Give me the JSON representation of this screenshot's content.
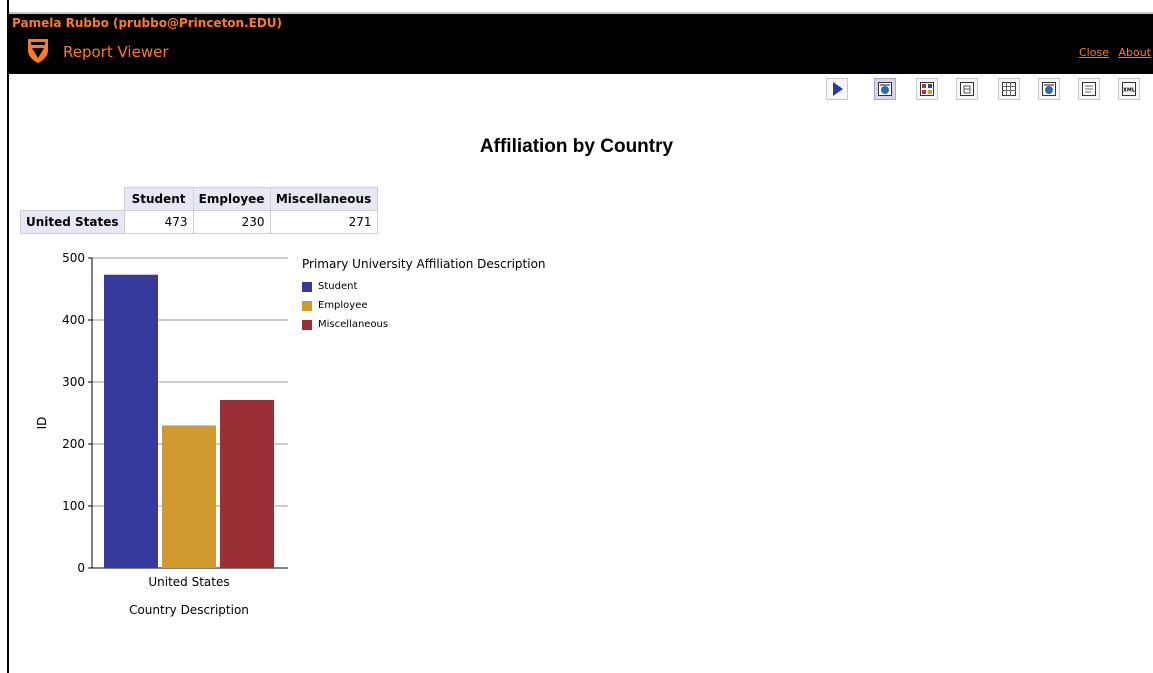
{
  "header": {
    "user": "Pamela Rubbo (prubbo@Princeton.EDU)",
    "app_title": "Report Viewer",
    "links": {
      "close": "Close",
      "about": "About"
    }
  },
  "toolbar": {
    "buttons": [
      {
        "name": "run-button",
        "icon": "play-icon"
      },
      {
        "name": "view-chart-button",
        "icon": "chart-view-icon",
        "active": true
      },
      {
        "name": "view-chart-table-button",
        "icon": "chart-table-icon"
      },
      {
        "name": "view-table-button",
        "icon": "crosstab-icon"
      },
      {
        "name": "view-grid-button",
        "icon": "grid-icon"
      },
      {
        "name": "export-chart-button",
        "icon": "chart-export-icon"
      },
      {
        "name": "export-text-button",
        "icon": "text-export-icon"
      },
      {
        "name": "export-xml-button",
        "icon": "xml-icon",
        "label": "XML"
      }
    ]
  },
  "report": {
    "title": "Affiliation by Country",
    "table": {
      "columns": [
        "Student",
        "Employee",
        "Miscellaneous"
      ],
      "rows": [
        {
          "label": "United States",
          "values": [
            "473",
            "230",
            "271"
          ]
        }
      ]
    }
  },
  "chart_data": {
    "type": "bar",
    "categories": [
      "United States"
    ],
    "series": [
      {
        "name": "Student",
        "values": [
          473
        ],
        "color": "#353a9c"
      },
      {
        "name": "Employee",
        "values": [
          230
        ],
        "color": "#d09a30"
      },
      {
        "name": "Miscellaneous",
        "values": [
          271
        ],
        "color": "#9a3035"
      }
    ],
    "xlabel": "Country Description",
    "ylabel": "ID",
    "ylim": [
      0,
      500
    ],
    "yticks": [
      "0",
      "100",
      "200",
      "300",
      "400",
      "500"
    ],
    "legend_title": "Primary University Affiliation Description",
    "legend_position": "right",
    "grid": true
  },
  "colors": {
    "brand_orange": "#ff7a1a",
    "header_bg": "#000000"
  }
}
